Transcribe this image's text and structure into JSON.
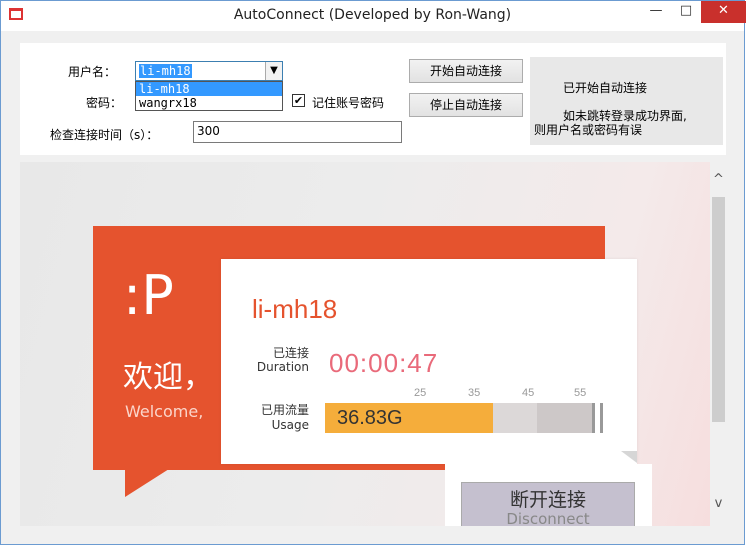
{
  "window": {
    "title": "AutoConnect (Developed by Ron-Wang)",
    "minimize_glyph": "—",
    "maximize_glyph": "□",
    "close_glyph": "✕"
  },
  "form": {
    "username_label": "用户名：",
    "username_value": "li-mh18",
    "username_options": [
      "li-mh18",
      "wangrx18"
    ],
    "password_label": "密码：",
    "remember_label": "记住账号密码",
    "remember_checked": true,
    "check_glyph": "✔",
    "interval_label": "检查连接时间（s）：",
    "interval_value": "300",
    "start_button": "开始自动连接",
    "stop_button": "停止自动连接"
  },
  "status": {
    "line1": "已开始自动连接",
    "line2": "如未跳转登录成功界面,",
    "line3": "则用户名或密码有误"
  },
  "portal": {
    "smiley": ":P",
    "welcome_cn": "欢迎，",
    "welcome_en": "Welcome,",
    "user": "li-mh18",
    "connected_cn": "已连接",
    "connected_en": "Duration",
    "duration": "00:00:47",
    "usage_cn": "已用流量",
    "usage_en": "Usage",
    "usage_value": "36.83G",
    "usage_fraction": 0.628,
    "ticks": [
      "25",
      "35",
      "45",
      "55"
    ],
    "disconnect_cn": "断开连接",
    "disconnect_en": "Disconnect"
  },
  "scrollbar": {
    "up_glyph": "^",
    "down_glyph": "v"
  },
  "colors": {
    "accent": "#e5532e",
    "usage_fill": "#f5ad3b",
    "duration": "#e96a7a",
    "selection": "#3399ff"
  }
}
